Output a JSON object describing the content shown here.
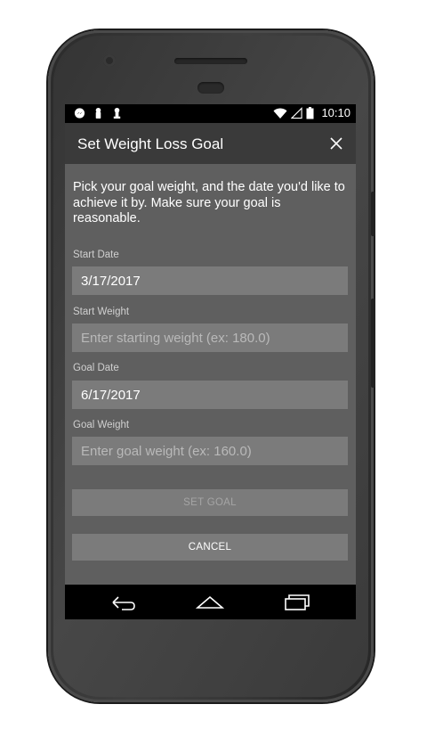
{
  "status_bar": {
    "time": "10:10",
    "left_icons": [
      "messenger-icon",
      "notification-icon",
      "notification-icon"
    ],
    "right_icons": [
      "wifi-icon",
      "signal-icon",
      "battery-icon"
    ]
  },
  "dialog": {
    "title": "Set Weight Loss Goal",
    "instructions": "Pick your goal weight, and the date you'd like to achieve it by. Make sure your goal is reasonable."
  },
  "fields": {
    "start_date": {
      "label": "Start Date",
      "value": "3/17/2017"
    },
    "start_weight": {
      "label": "Start Weight",
      "placeholder": "Enter starting weight (ex: 180.0)"
    },
    "goal_date": {
      "label": "Goal Date",
      "value": "6/17/2017"
    },
    "goal_weight": {
      "label": "Goal Weight",
      "placeholder": "Enter goal weight (ex: 160.0)"
    }
  },
  "buttons": {
    "set_goal": "SET GOAL",
    "cancel": "CANCEL"
  },
  "nav_bar": [
    "back-icon",
    "home-icon",
    "recents-icon"
  ],
  "colors": {
    "overlay": "#5f5f5f",
    "field_bg": "#7b7b7b",
    "header_bg": "#3a3a3a"
  }
}
